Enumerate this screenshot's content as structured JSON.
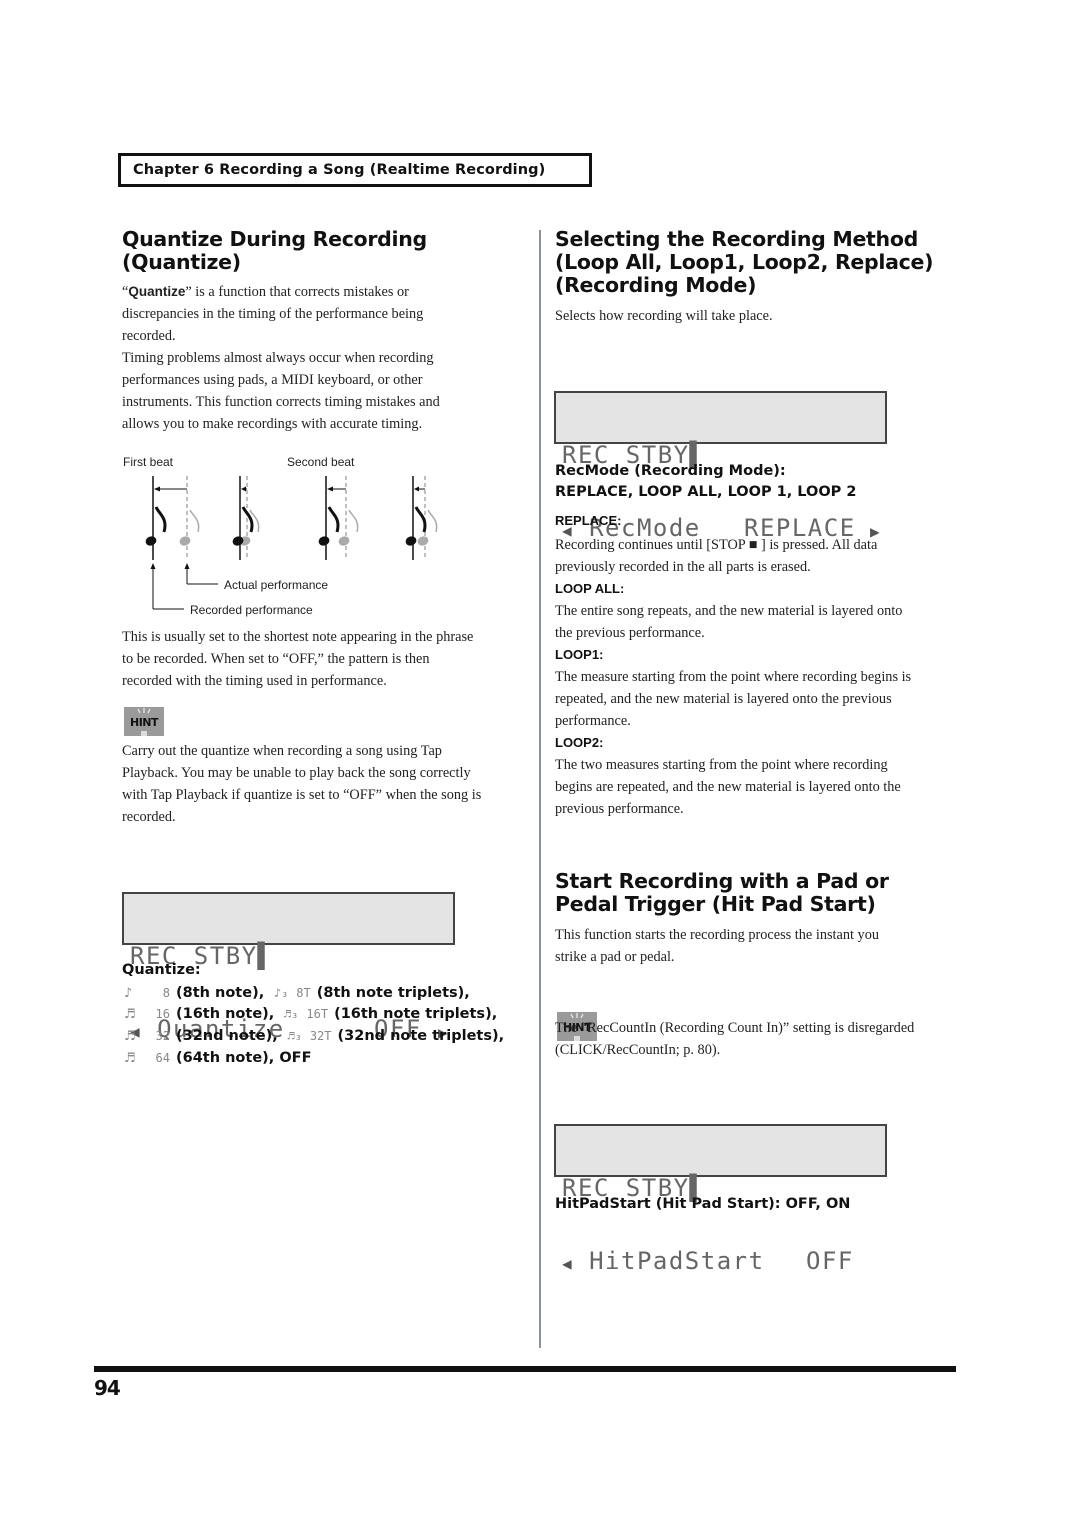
{
  "header": {
    "chapter_title": "Chapter 6 Recording a Song (Realtime Recording)"
  },
  "left": {
    "section_title_line1": "Quantize During Recording",
    "section_title_line2": "(Quantize)",
    "intro": {
      "quote_open": "“",
      "term": "Quantize",
      "rest_line1": "” is a function that corrects mistakes or",
      "line2": "discrepancies in the timing of the performance being",
      "line3": "recorded."
    },
    "para2": [
      "Timing problems almost always occur when recording",
      "performances using pads, a MIDI keyboard, or other",
      "instruments. This function corrects timing mistakes and",
      "allows you to make recordings with accurate timing."
    ],
    "figure": {
      "first_beat": "First beat",
      "second_beat": "Second beat",
      "actual_performance": "Actual performance",
      "recorded_performance": "Recorded performance"
    },
    "para3": [
      "This is usually set to the shortest note appearing in the phrase",
      "to be recorded. When set to “OFF,” the pattern is then",
      "recorded with the timing used in performance."
    ],
    "hint_label": "HINT",
    "hint_text": [
      "Carry out the quantize when recording a song using Tap",
      "Playback. You may be unable to play back the song correctly",
      "with Tap Playback if quantize is set to “OFF” when the song is",
      "recorded."
    ],
    "lcd": {
      "line1": "REC STBY▌",
      "arrow_left": "◀",
      "param": "Quantize",
      "value": "OFF",
      "arrow_right": "▶"
    },
    "quantize_label": "Quantize:",
    "quantize_options": [
      {
        "glyph": "♪",
        "code": "8",
        "desc": "(8th note),",
        "glyph2": "♪₃",
        "code2": "8T",
        "desc2": "(8th note triplets),"
      },
      {
        "glyph": "♬",
        "code": "16",
        "desc": "(16th note),",
        "glyph2": "♬₃",
        "code2": "16T",
        "desc2": "(16th note triplets),"
      },
      {
        "glyph": "♬",
        "code": "32",
        "desc": "(32nd note),",
        "glyph2": "♬₃",
        "code2": "32T",
        "desc2": "(32nd note triplets),"
      },
      {
        "glyph": "♬",
        "code": "64",
        "desc": "(64th note), OFF"
      }
    ]
  },
  "right": {
    "section_title_lines": [
      "Selecting the Recording Method",
      "(Loop All, Loop1, Loop2, Replace)",
      "(Recording Mode)"
    ],
    "intro": "Selects how recording will take place.",
    "lcd": {
      "line1": "REC STBY▌",
      "arrow_left": "◀",
      "param": "RecMode",
      "value": "REPLACE",
      "arrow_right": "▶"
    },
    "recmode_label_line1": "RecMode (Recording Mode):",
    "recmode_label_line2": "REPLACE, LOOP ALL, LOOP 1, LOOP 2",
    "modes": [
      {
        "name": "REPLACE:",
        "lines": [
          "Recording continues until [STOP ■ ] is pressed. All data",
          "previously recorded in the all parts is erased."
        ]
      },
      {
        "name": "LOOP ALL:",
        "lines": [
          "The entire song repeats, and the new material is layered onto",
          "the previous performance."
        ]
      },
      {
        "name": "LOOP1:",
        "lines": [
          "The measure starting from the point where recording begins is",
          "repeated, and the new material is layered onto the previous",
          "performance."
        ]
      },
      {
        "name": "LOOP2:",
        "lines": [
          "The two measures starting from the point where recording",
          "begins are repeated, and the new material is layered onto the",
          "previous performance."
        ]
      }
    ],
    "section2_title_lines": [
      "Start Recording with a Pad or",
      "Pedal Trigger (Hit Pad Start)"
    ],
    "section2_intro": [
      "This function starts the recording process the instant you",
      "strike a pad or pedal."
    ],
    "hint_label": "HINT",
    "hint_text": [
      "The “RecCountIn (Recording Count In)” setting is disregarded",
      "(CLICK/RecCountIn; p. 80)."
    ],
    "lcd2": {
      "line1": "REC STBY▌",
      "arrow_left": "◀",
      "param": "HitPadStart",
      "value": "OFF"
    },
    "hitpad_label": "HitPadStart (Hit Pad Start): OFF, ON"
  },
  "footer": {
    "page_number": "94"
  }
}
